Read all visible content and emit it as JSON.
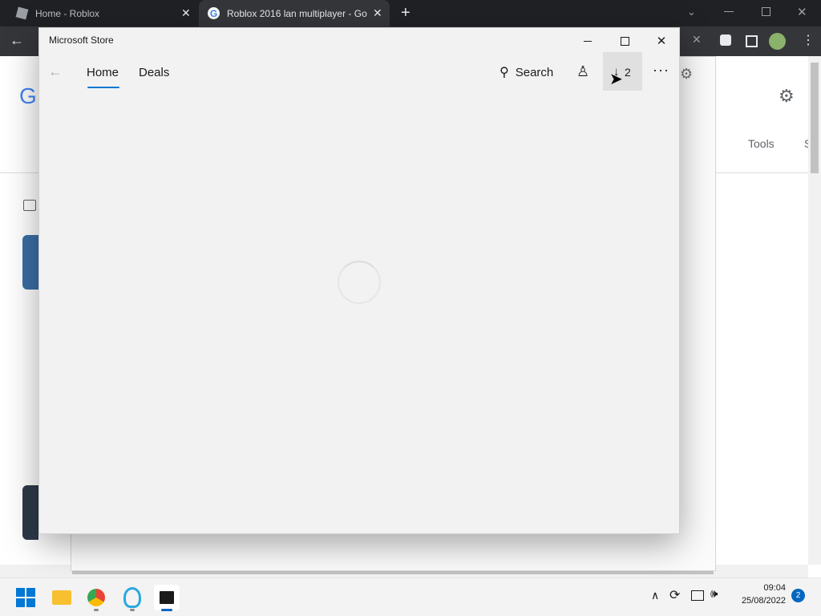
{
  "browser": {
    "tabs": [
      {
        "title": "Home - Roblox"
      },
      {
        "title": "Roblox 2016 lan multiplayer - Go"
      }
    ],
    "page_tools_label": "Tools",
    "page_partial_label": "S"
  },
  "store": {
    "title": "Microsoft Store",
    "nav": {
      "home": "Home",
      "deals": "Deals"
    },
    "search_label": "Search",
    "downloads_count": "2",
    "accent_color": "#0078d4",
    "loading": true
  },
  "taskbar": {
    "time": "09:04",
    "date": "25/08/2022",
    "notification_count": "2"
  }
}
